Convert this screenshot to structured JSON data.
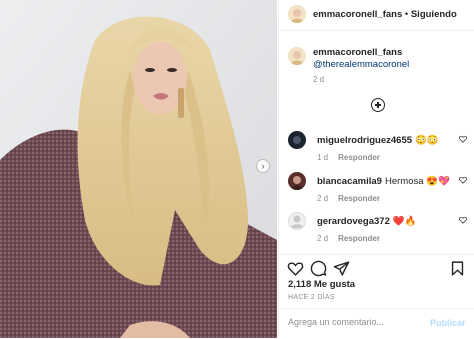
{
  "post": {
    "username": "emmacoronell_fans",
    "separator": "•",
    "follow_label": "Siguiendo",
    "caption_user": "emmacoronell_fans",
    "caption_mention": "@therealemmacoronel",
    "caption_time": "2 d",
    "likes": "2,118 Me gusta",
    "posted_ago": "HACE 2 DÍAS"
  },
  "comments": [
    {
      "user": "miguelrodriguez4655",
      "text": "😳😳",
      "time": "1 d",
      "reply_label": "Responder"
    },
    {
      "user": "blancacamila9",
      "text": "Hermosa 😍💖",
      "time": "2 d",
      "reply_label": "Responder"
    },
    {
      "user": "gerardovega372",
      "text": "❤️🔥",
      "time": "2 d",
      "reply_label": "Responder"
    }
  ],
  "add_comment": {
    "placeholder": "Agrega un comentario...",
    "publish_label": "Publicar"
  },
  "icons": {
    "next": "chevron-right-icon",
    "load_more": "plus-circle-icon",
    "like": "heart-icon",
    "comment": "comment-icon",
    "share": "paper-plane-icon",
    "save": "bookmark-icon"
  },
  "colors": {
    "mention": "#00376b",
    "muted": "#8e8e8e",
    "publish_disabled": "#b2dffc",
    "dress": "#6e4a52"
  }
}
